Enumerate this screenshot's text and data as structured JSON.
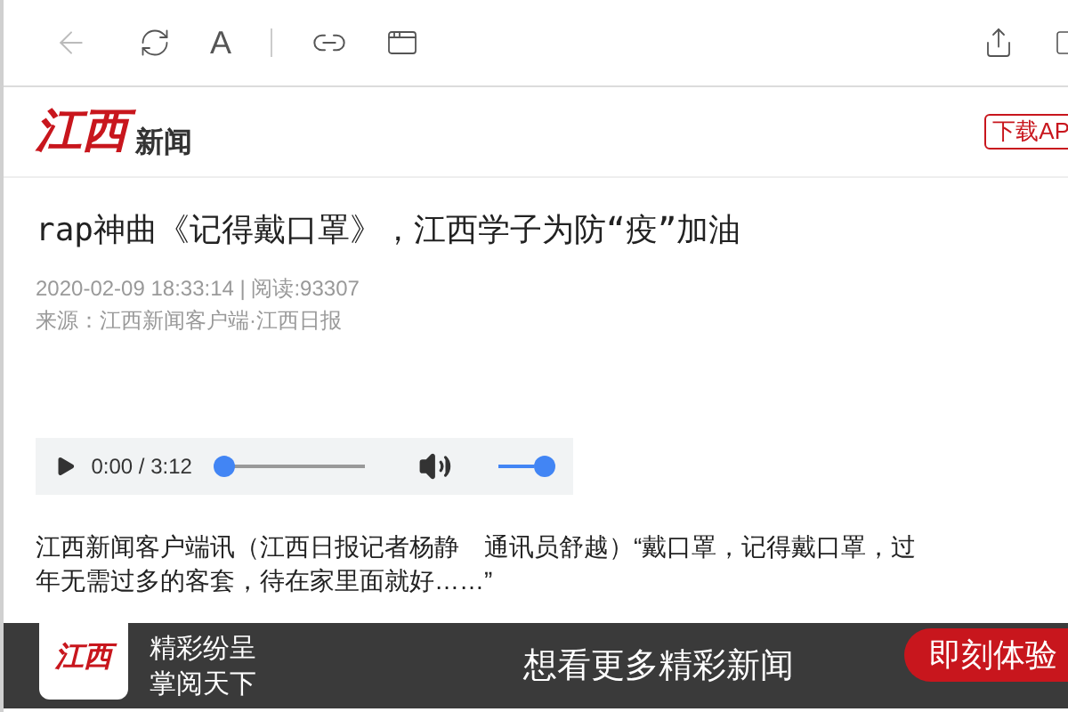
{
  "toolbar": {
    "font_button": "A"
  },
  "header": {
    "logo_red": "江西",
    "logo_black": "新闻",
    "download_button": "下载AP"
  },
  "article": {
    "title": "rap神曲《记得戴口罩》，江西学子为防“疫”加油",
    "meta": "2020-02-09 18:33:14 | 阅读:93307",
    "source": "来源：江西新闻客户端·江西日报",
    "audio": {
      "time": "0:00 / 3:12",
      "progress": {
        "level": 0
      },
      "volume": {
        "level": 1
      }
    },
    "paragraph_1": [
      "江西新闻客户端讯（江西日报记者杨静　通讯员舒越）“戴口罩，记得戴口罩，过",
      "年无需过多的客套，待在家里面就好……”"
    ]
  },
  "banner": {
    "logo": "江西",
    "line_1": "精彩纷呈",
    "line_2": "掌阅天下",
    "slogan": "想看更多精彩新闻",
    "button": "即刻体验"
  }
}
